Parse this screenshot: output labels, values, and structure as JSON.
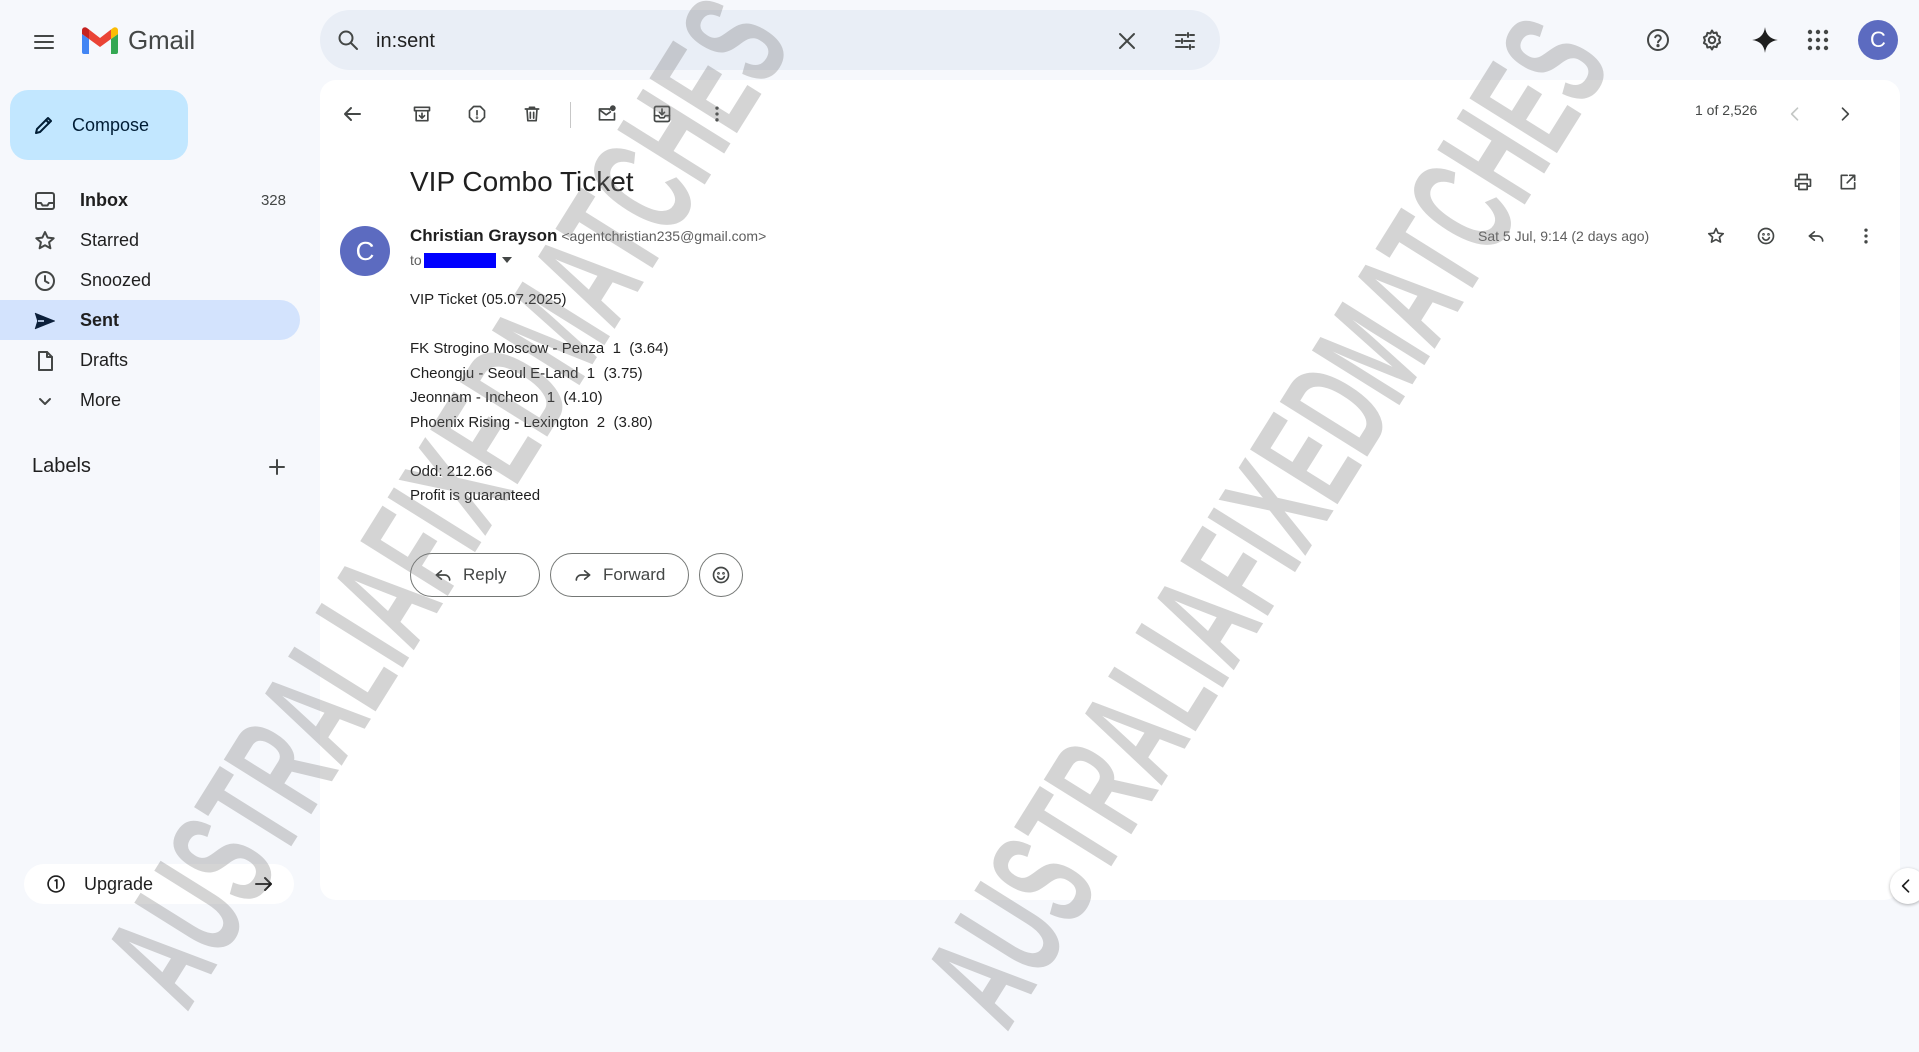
{
  "app": {
    "logo_text": "Gmail",
    "brand_colors": {
      "accent": "#0b57d0",
      "compose_bg": "#c2e7ff",
      "active_nav": "#d3e3fd"
    }
  },
  "search": {
    "query": "in:sent"
  },
  "user": {
    "avatar_letter": "C"
  },
  "sidebar": {
    "compose_label": "Compose",
    "items": [
      {
        "label": "Inbox",
        "count": "328",
        "icon": "inbox-icon"
      },
      {
        "label": "Starred",
        "count": "",
        "icon": "star-icon"
      },
      {
        "label": "Snoozed",
        "count": "",
        "icon": "clock-icon"
      },
      {
        "label": "Sent",
        "count": "",
        "icon": "send-icon"
      },
      {
        "label": "Drafts",
        "count": "",
        "icon": "draft-icon"
      },
      {
        "label": "More",
        "count": "",
        "icon": "chevron-down-icon"
      }
    ],
    "labels_heading": "Labels",
    "upgrade_label": "Upgrade"
  },
  "toolbar": {
    "pager": "1 of 2,526"
  },
  "email": {
    "subject": "VIP Combo Ticket",
    "sender_initial": "C",
    "sender_name": "Christian Grayson",
    "sender_email": "<agentchristian235@gmail.com>",
    "to_prefix": "to",
    "date": "Sat 5 Jul, 9:14 (2 days ago)",
    "body_lines": [
      "VIP Ticket (05.07.2025)",
      "",
      "FK Strogino Moscow - Penza  1  (3.64)",
      "Cheongju - Seoul E-Land  1  (3.75)",
      "Jeonnam - Incheon  1  (4.10)",
      "Phoenix Rising - Lexington  2  (3.80)",
      "",
      "Odd: 212.66",
      "Profit is guaranteed"
    ],
    "reply_label": "Reply",
    "forward_label": "Forward"
  },
  "watermark": {
    "text": "AUSTRALIAFIXEDMATCHES"
  }
}
